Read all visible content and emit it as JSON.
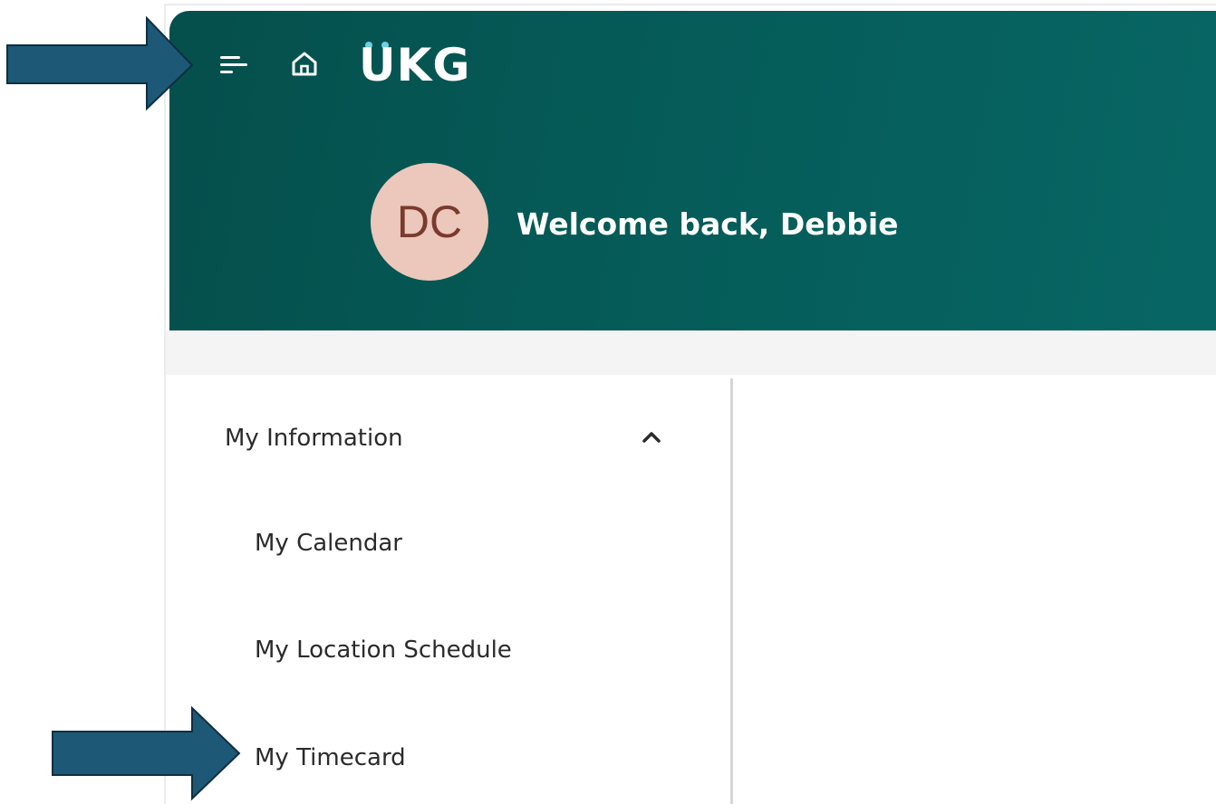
{
  "header": {
    "menu_icon": "hamburger-menu-icon",
    "home_icon": "home-icon",
    "logo_text": "UKG",
    "brand_color": "#055b58",
    "logo_dot_color": "#6fd0e2"
  },
  "profile": {
    "initials": "DC",
    "avatar_color": "#ecc7bb",
    "welcome": "Welcome back, Debbie"
  },
  "sidebar": {
    "section_label": "My Information",
    "section_expanded": true,
    "items": [
      {
        "label": "My Calendar"
      },
      {
        "label": "My Location Schedule"
      },
      {
        "label": "My Timecard"
      }
    ]
  },
  "annotations": {
    "arrow_color": "#1d5877",
    "arrow_targets": [
      "menu",
      "My Timecard"
    ]
  }
}
